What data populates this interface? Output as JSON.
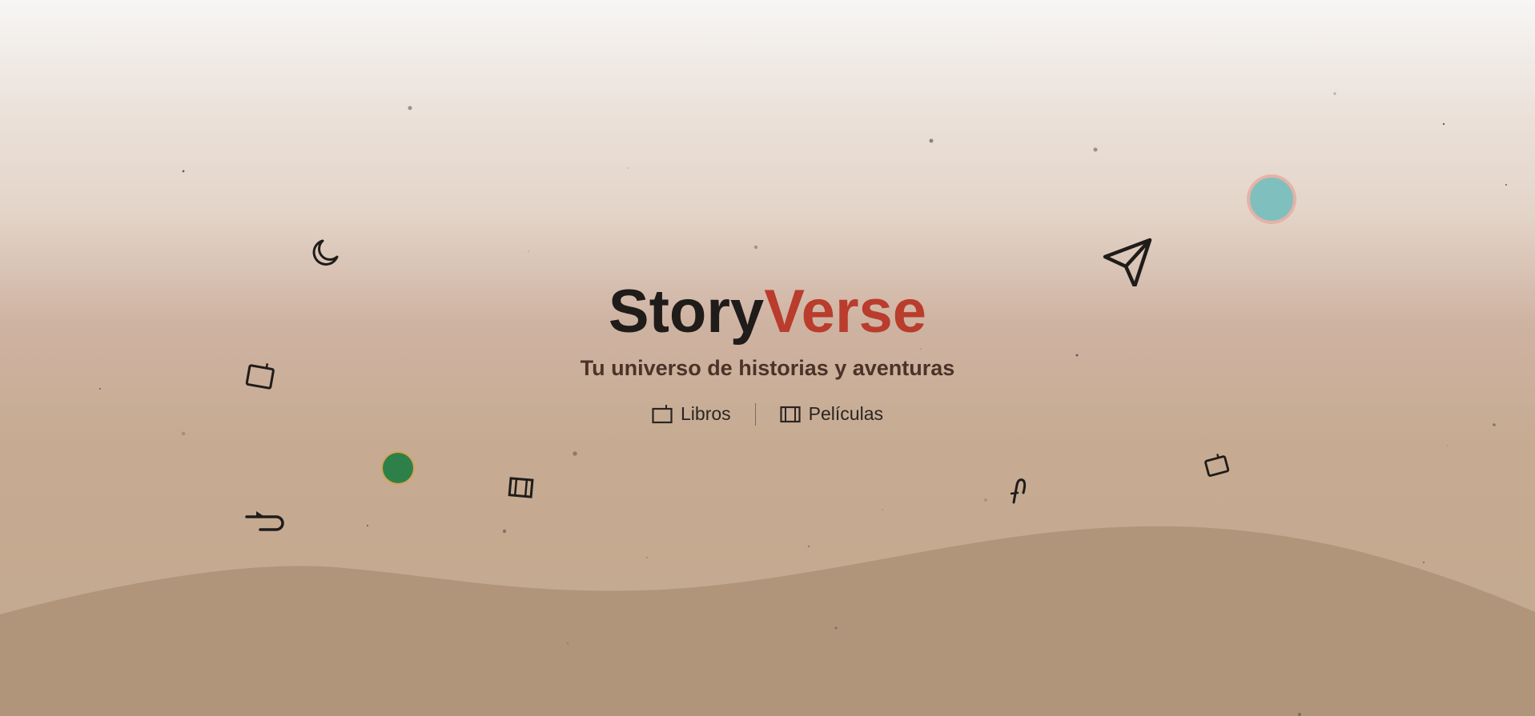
{
  "brand": {
    "title_part1": "Story",
    "title_part2": "Verse",
    "accent_color": "#b93c2c",
    "subtitle": "Tu universo de historias y aventuras"
  },
  "nav": [
    {
      "label": "Libros",
      "icon": "book-icon"
    },
    {
      "label": "Películas",
      "icon": "film-icon"
    }
  ],
  "decorations": {
    "icons": [
      "moon-icon",
      "tv-icon",
      "return-arrow-icon",
      "film-icon",
      "paper-plane-icon",
      "music-note-icon",
      "tv-icon"
    ],
    "orbs": [
      {
        "name": "green-orb",
        "color": "#2e8049"
      },
      {
        "name": "teal-orb",
        "color": "#7fc0be"
      }
    ]
  },
  "colors": {
    "wave": "#b0957a",
    "ink": "#1f1c1a"
  }
}
